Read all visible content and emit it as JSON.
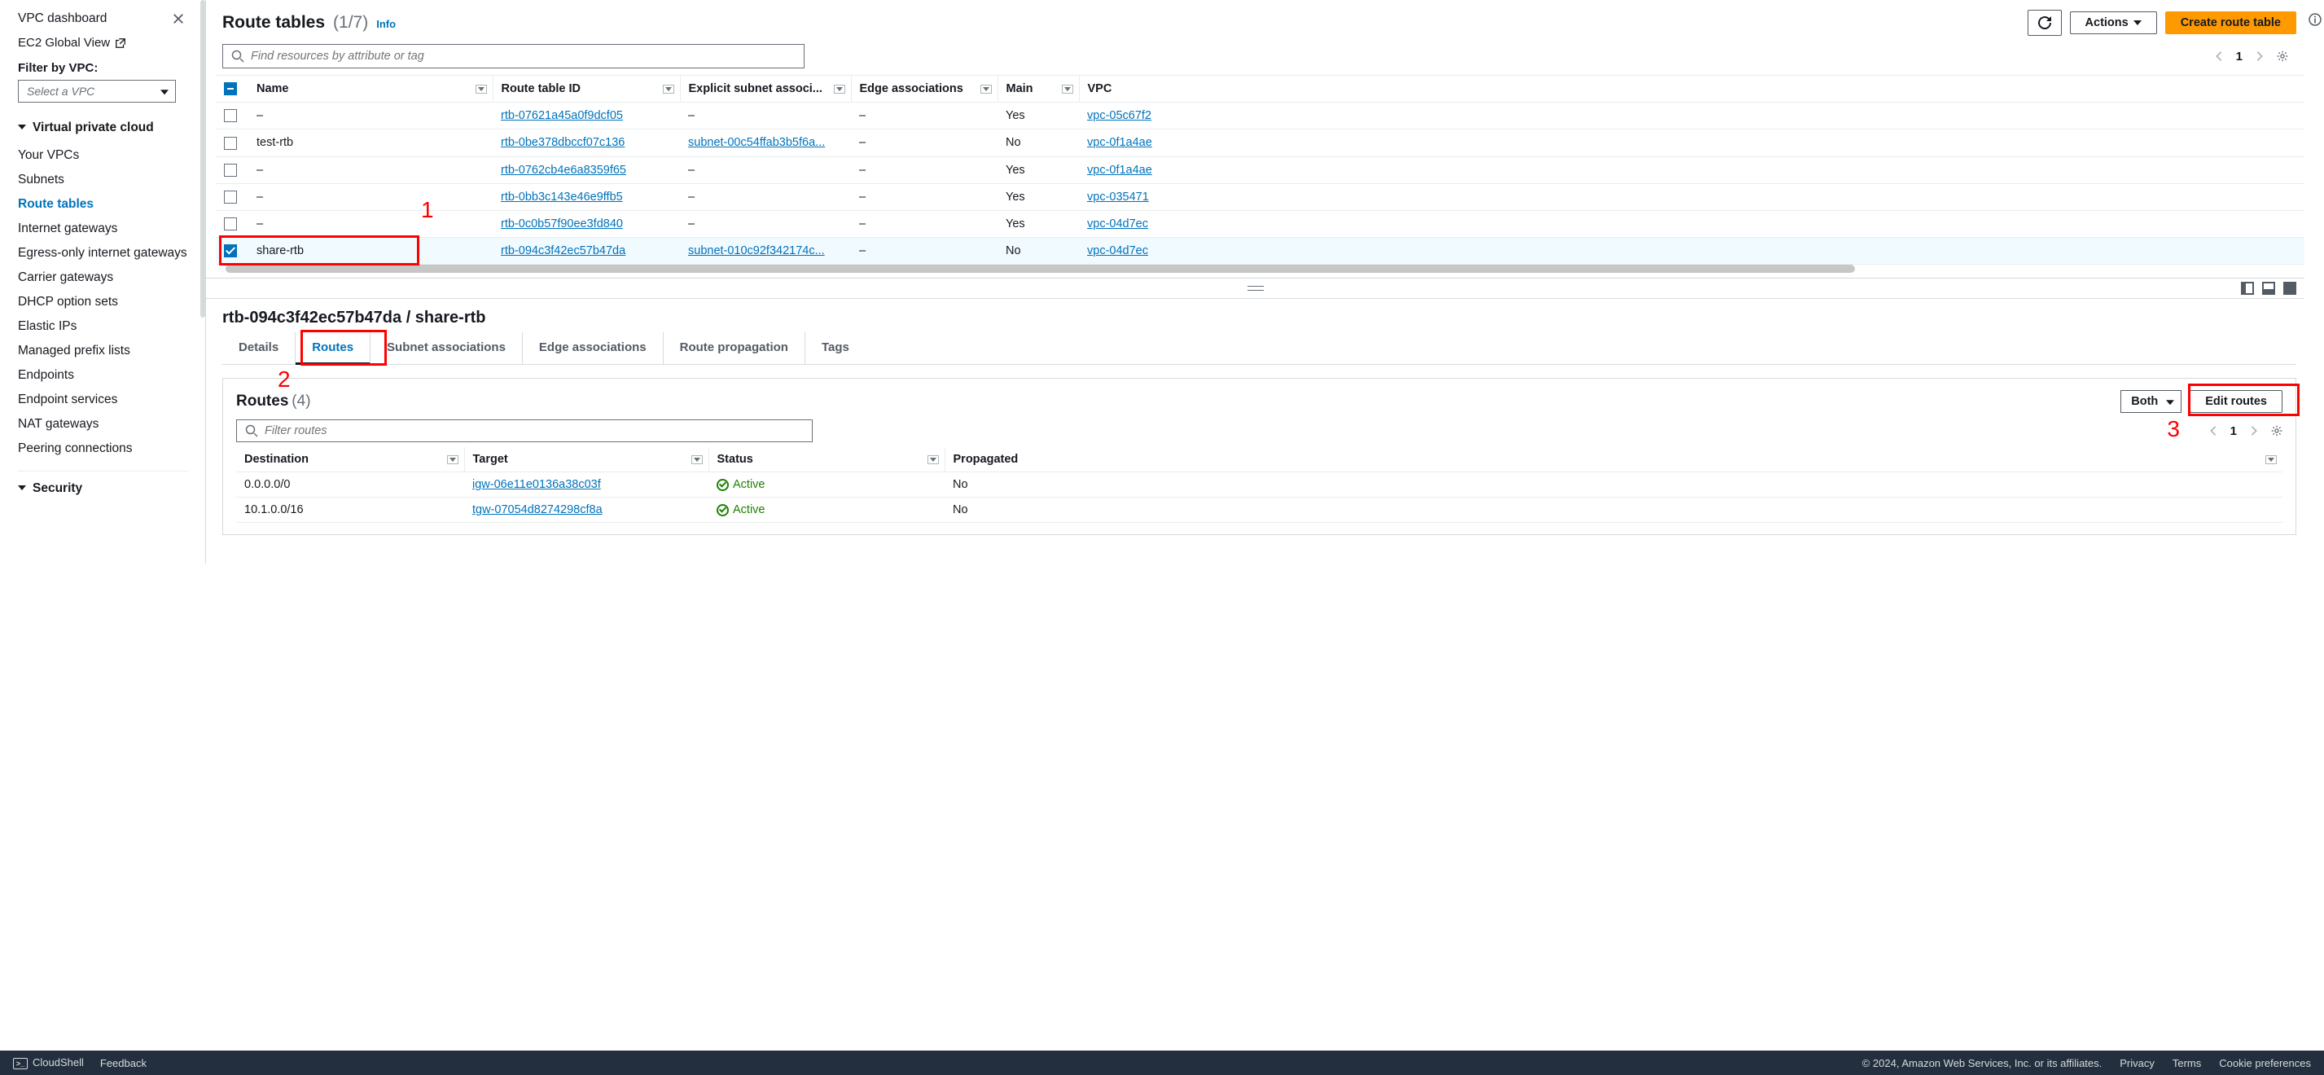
{
  "sidebar": {
    "title": "VPC dashboard",
    "ec2_global": "EC2 Global View",
    "filter_label": "Filter by VPC:",
    "select_placeholder": "Select a VPC",
    "section_vpc_title": "Virtual private cloud",
    "nav": {
      "your_vpcs": "Your VPCs",
      "subnets": "Subnets",
      "route_tables": "Route tables",
      "internet_gateways": "Internet gateways",
      "egress_only": "Egress-only internet gateways",
      "carrier_gateways": "Carrier gateways",
      "dhcp": "DHCP option sets",
      "elastic_ips": "Elastic IPs",
      "managed_prefix": "Managed prefix lists",
      "endpoints": "Endpoints",
      "endpoint_services": "Endpoint services",
      "nat_gateways": "NAT gateways",
      "peering": "Peering connections"
    },
    "section_security_title": "Security"
  },
  "header": {
    "title": "Route tables",
    "count": "(1/7)",
    "info": "Info",
    "actions": "Actions",
    "create": "Create route table",
    "search_placeholder": "Find resources by attribute or tag",
    "page": "1"
  },
  "columns": {
    "name": "Name",
    "rtb_id": "Route table ID",
    "subnet_assoc": "Explicit subnet associ...",
    "edge_assoc": "Edge associations",
    "main": "Main",
    "vpc": "VPC"
  },
  "rows": [
    {
      "name": "–",
      "rtb": "rtb-07621a45a0f9dcf05",
      "subnet": "–",
      "edge": "–",
      "main": "Yes",
      "vpc": "vpc-05c67f2"
    },
    {
      "name": "test-rtb",
      "rtb": "rtb-0be378dbccf07c136",
      "subnet": "subnet-00c54ffab3b5f6a...",
      "edge": "–",
      "main": "No",
      "vpc": "vpc-0f1a4ae"
    },
    {
      "name": "–",
      "rtb": "rtb-0762cb4e6a8359f65",
      "subnet": "–",
      "edge": "–",
      "main": "Yes",
      "vpc": "vpc-0f1a4ae"
    },
    {
      "name": "–",
      "rtb": "rtb-0bb3c143e46e9ffb5",
      "subnet": "–",
      "edge": "–",
      "main": "Yes",
      "vpc": "vpc-035471"
    },
    {
      "name": "–",
      "rtb": "rtb-0c0b57f90ee3fd840",
      "subnet": "–",
      "edge": "–",
      "main": "Yes",
      "vpc": "vpc-04d7ec"
    },
    {
      "name": "share-rtb",
      "rtb": "rtb-094c3f42ec57b47da",
      "subnet": "subnet-010c92f342174c...",
      "edge": "–",
      "main": "No",
      "vpc": "vpc-04d7ec"
    }
  ],
  "detail": {
    "title": "rtb-094c3f42ec57b47da / share-rtb",
    "tabs": {
      "details": "Details",
      "routes": "Routes",
      "subnet_assoc": "Subnet associations",
      "edge_assoc": "Edge associations",
      "route_prop": "Route propagation",
      "tags": "Tags"
    },
    "routes_title": "Routes",
    "routes_count": "(4)",
    "both": "Both",
    "edit_routes": "Edit routes",
    "filter_placeholder": "Filter routes",
    "page": "1",
    "cols": {
      "dest": "Destination",
      "target": "Target",
      "status": "Status",
      "prop": "Propagated"
    },
    "routes": [
      {
        "dest": "0.0.0.0/0",
        "target": "igw-06e11e0136a38c03f",
        "status": "Active",
        "prop": "No"
      },
      {
        "dest": "10.1.0.0/16",
        "target": "tgw-07054d8274298cf8a",
        "status": "Active",
        "prop": "No"
      }
    ]
  },
  "annotations": {
    "n1": "1",
    "n2": "2",
    "n3": "3"
  },
  "footer": {
    "cloudshell": "CloudShell",
    "feedback": "Feedback",
    "copyright": "© 2024, Amazon Web Services, Inc. or its affiliates.",
    "privacy": "Privacy",
    "terms": "Terms",
    "cookie": "Cookie preferences"
  }
}
